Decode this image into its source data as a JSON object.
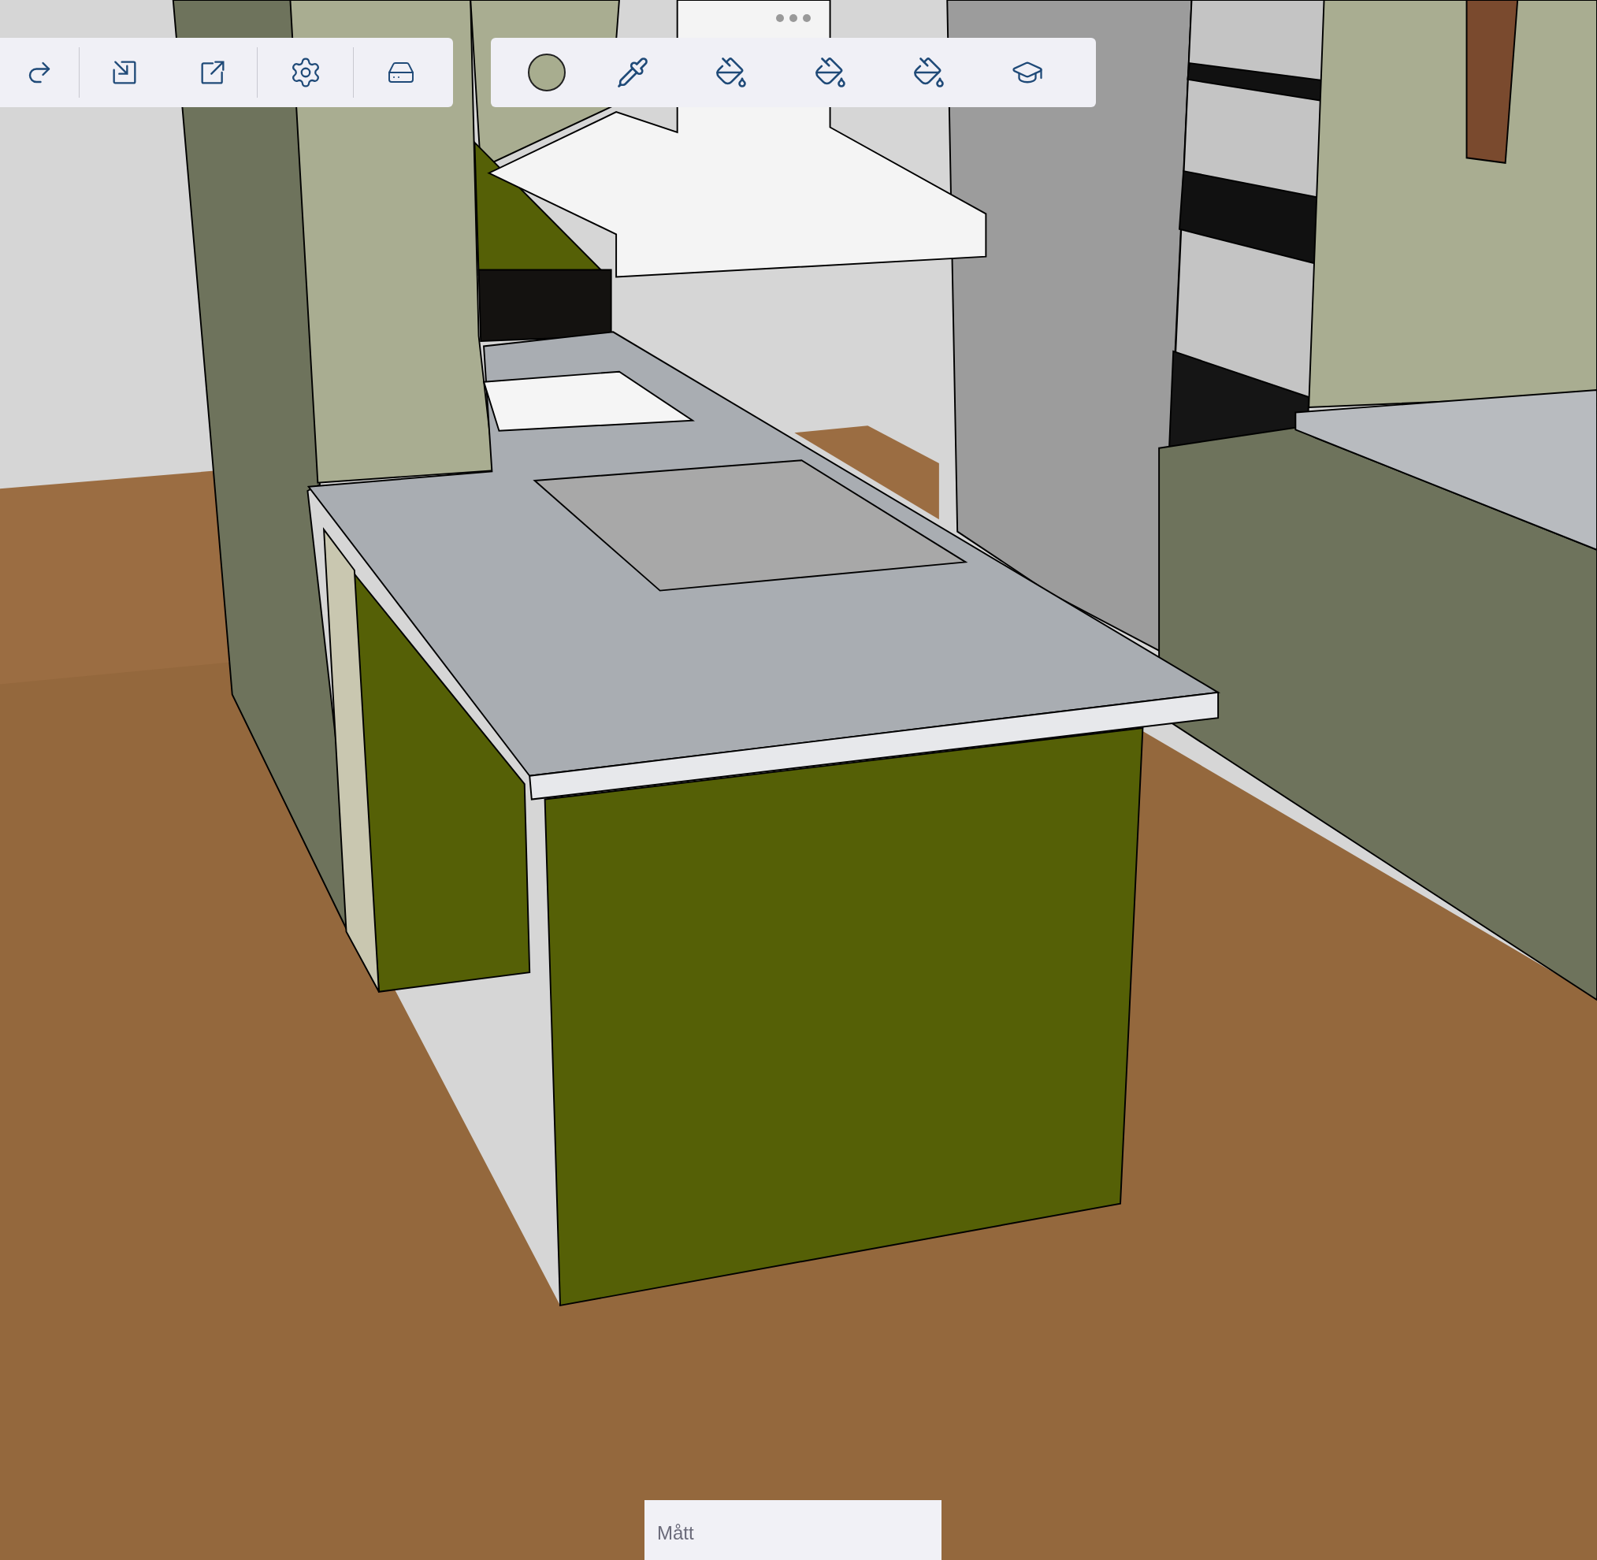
{
  "measurements_box": {
    "placeholder": "Mått"
  }
}
